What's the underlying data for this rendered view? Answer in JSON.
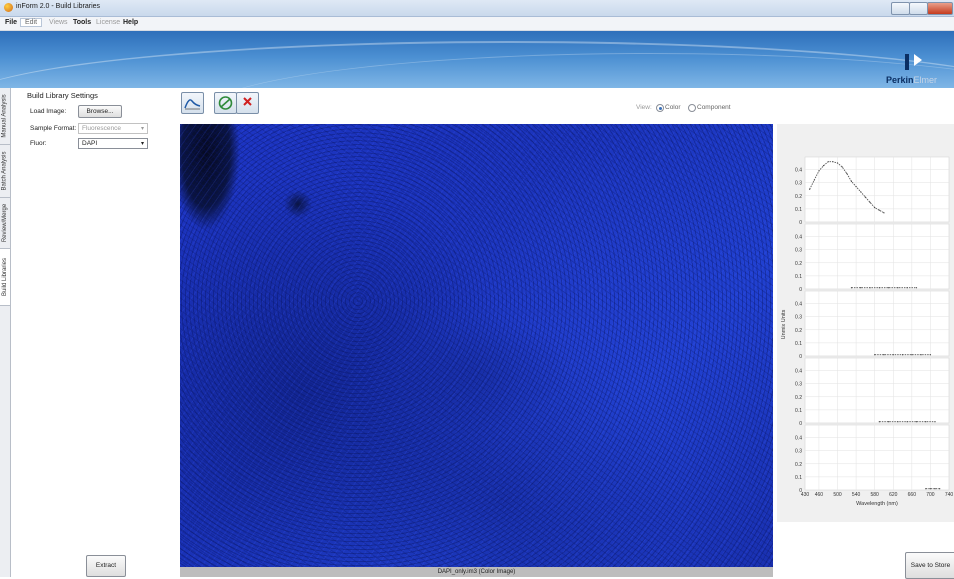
{
  "window": {
    "title": "inForm 2.0 - Build Libraries"
  },
  "menu": {
    "items": [
      "File",
      "Edit",
      "Views",
      "Tools",
      "License",
      "Help"
    ]
  },
  "brand": {
    "logo": "PerkinElmer",
    "logo_visible": "Perkin",
    "logo_faded": "Elmer"
  },
  "side_tabs": [
    "Manual Analysis",
    "Batch Analysis",
    "Review/Merge",
    "Build Libraries"
  ],
  "settings": {
    "title": "Build Library Settings",
    "load_image_label": "Load Image:",
    "browse_label": "Browse...",
    "sample_format_label": "Sample Format:",
    "sample_format_value": "Fluorescence",
    "fluor_label": "Fluor:",
    "fluor_value": "DAPI",
    "extract_label": "Extract"
  },
  "toolbar": {
    "icons": [
      "spectrum-curve-icon",
      "no-draw-icon",
      "delete-icon"
    ]
  },
  "view": {
    "label": "View:",
    "options": [
      "Color",
      "Component"
    ],
    "selected": "Color"
  },
  "image": {
    "caption": "DAPI_only.im3  (Color Image)"
  },
  "save_to_store_label": "Save to Store",
  "chart_data": {
    "type": "line",
    "panels": 5,
    "ylabel": "Unmix Units",
    "xlabel": "Wavelength (nm)",
    "x_ticks": [
      430,
      460,
      500,
      540,
      580,
      620,
      660,
      700,
      740
    ],
    "xlim": [
      430,
      740
    ],
    "y_ticks": [
      0,
      0.1,
      0.2,
      0.3,
      0.4
    ],
    "ylim": [
      0,
      0.45
    ],
    "grid": true,
    "series": [
      {
        "panel": 0,
        "x": [
          440,
          450,
          460,
          470,
          480,
          490,
          500,
          510,
          520,
          530,
          540,
          550,
          560,
          570,
          580,
          590,
          600
        ],
        "values": [
          0.25,
          0.32,
          0.39,
          0.43,
          0.46,
          0.46,
          0.45,
          0.42,
          0.37,
          0.31,
          0.27,
          0.23,
          0.19,
          0.15,
          0.11,
          0.09,
          0.07
        ]
      },
      {
        "panel": 1,
        "x": [
          530,
          550,
          570,
          590,
          610,
          630,
          650,
          670
        ],
        "values": [
          0.01,
          0.01,
          0.01,
          0.01,
          0.01,
          0.01,
          0.01,
          0.01
        ]
      },
      {
        "panel": 2,
        "x": [
          580,
          600,
          620,
          640,
          660,
          680,
          700
        ],
        "values": [
          0.01,
          0.01,
          0.01,
          0.01,
          0.01,
          0.01,
          0.01
        ]
      },
      {
        "panel": 3,
        "x": [
          590,
          610,
          630,
          650,
          670,
          690,
          710
        ],
        "values": [
          0.01,
          0.01,
          0.01,
          0.01,
          0.01,
          0.01,
          0.01
        ]
      },
      {
        "panel": 4,
        "x": [
          690,
          700,
          710,
          720
        ],
        "values": [
          0.01,
          0.01,
          0.01,
          0.01
        ]
      }
    ]
  },
  "colors": {
    "accent": "#3a6fb8",
    "banner": "#4b8fd2",
    "image_blue": "#1d35c4",
    "close_red": "#c53b1e"
  }
}
